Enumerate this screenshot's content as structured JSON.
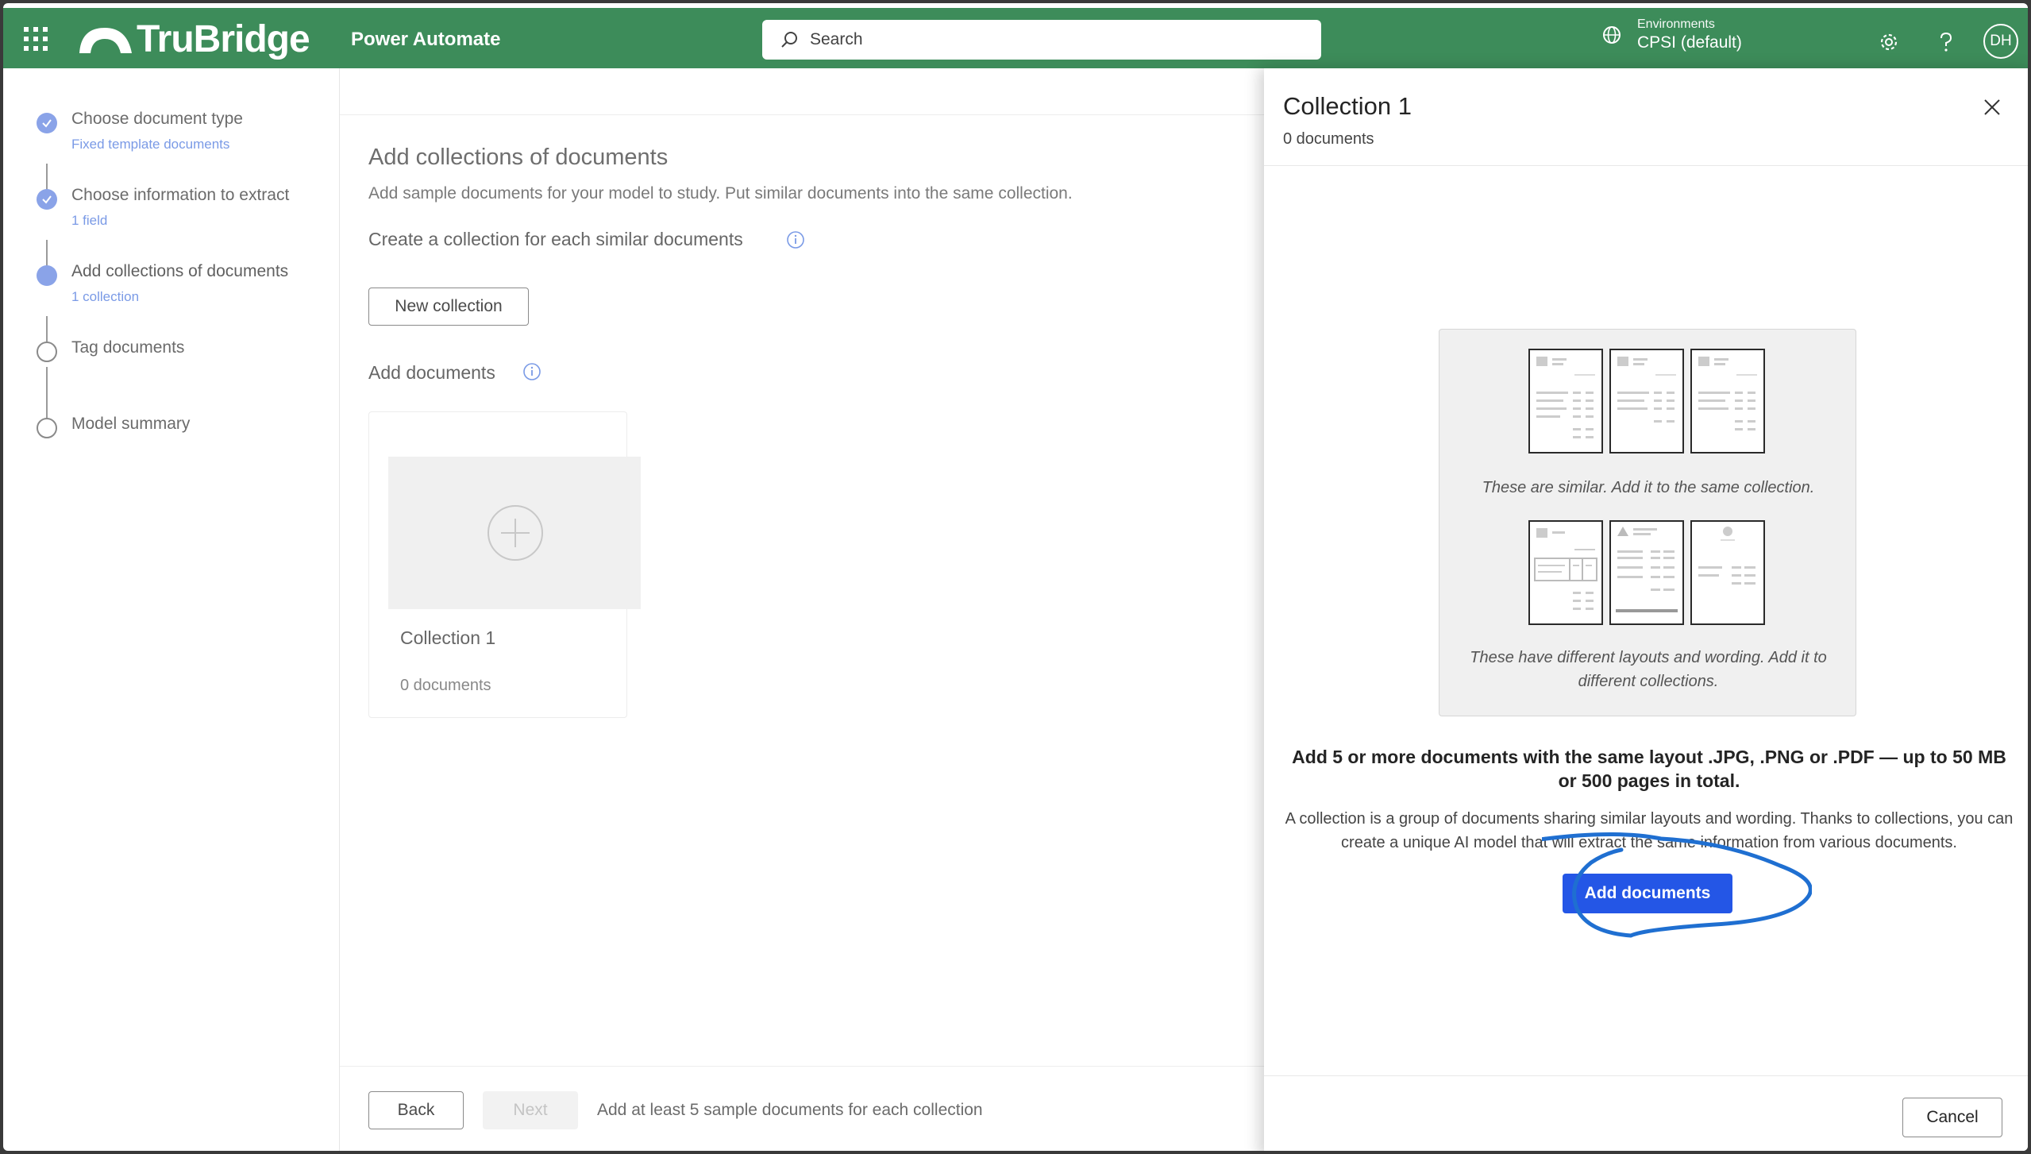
{
  "header": {
    "brand": "TruBridge",
    "app_name": "Power Automate",
    "search_placeholder": "Search",
    "env_caption": "Environments",
    "env_name": "CPSI (default)",
    "avatar_initials": "DH",
    "bg_color": "#3d8c5a",
    "icons": [
      "waffle-icon",
      "environment-icon",
      "gear-icon",
      "help-icon"
    ]
  },
  "stepper": {
    "steps": [
      {
        "title": "Choose document type",
        "subtitle": "Fixed template documents",
        "state": "done"
      },
      {
        "title": "Choose information to extract",
        "subtitle": "1 field",
        "state": "done"
      },
      {
        "title": "Add collections of documents",
        "subtitle": "1 collection",
        "state": "current"
      },
      {
        "title": "Tag documents",
        "subtitle": "",
        "state": "todo"
      },
      {
        "title": "Model summary",
        "subtitle": "",
        "state": "todo"
      }
    ]
  },
  "main": {
    "title": "Add collections of documents",
    "description": "Add sample documents for your model to study. Put similar documents into the same collection.",
    "collection_heading": "Create a collection for each similar documents",
    "new_collection_label": "New collection",
    "add_documents_heading": "Add documents",
    "card": {
      "title": "Collection 1",
      "count": "0 documents"
    },
    "footer": {
      "back_label": "Back",
      "next_label": "Next",
      "hint": "Add at least 5 sample documents for each collection"
    }
  },
  "panel": {
    "title": "Collection 1",
    "subtitle": "0 documents",
    "caption_similar": "These are similar. Add it to the same collection.",
    "caption_different": "These have different layouts and wording. Add it to different collections.",
    "bold_text": "Add 5 or more documents with the same layout .JPG, .PNG or .PDF — up to 50 MB or 500 pages in total.",
    "body_text": "A collection is a group of documents sharing similar layouts and wording. Thanks to collections, you can create a unique AI model that will extract the same information from various documents.",
    "add_documents_label": "Add documents",
    "cancel_label": "Cancel",
    "accent_color": "#2456e6",
    "annotation_color": "#1f6fd1"
  }
}
